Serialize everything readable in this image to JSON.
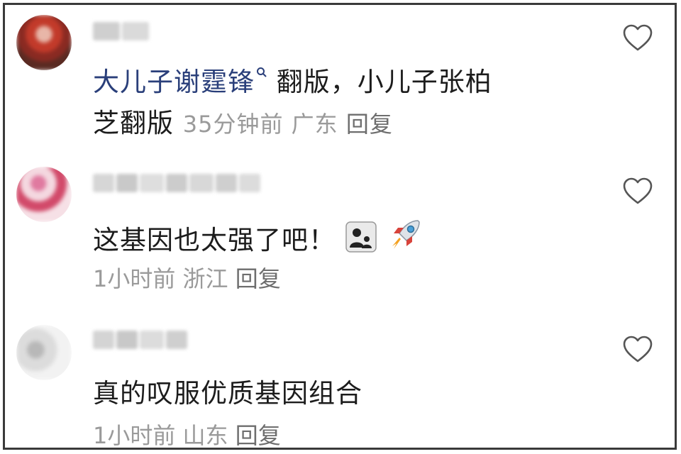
{
  "comments": [
    {
      "mention": "大儿子谢霆锋",
      "text_after_mention": " 翻版，小儿子张柏",
      "text_line2": "芝翻版",
      "time": "35分钟前",
      "location": "广东",
      "reply_label": "回复",
      "avatar_icon": "avatar-photo-blurred",
      "like_icon": "heart-outline-icon"
    },
    {
      "text": "这基因也太强了吧！",
      "emojis": [
        "busts-in-silhouette-emoji",
        "rocket-emoji"
      ],
      "time": "1小时前",
      "location": "浙江",
      "reply_label": "回复",
      "avatar_icon": "avatar-photo-blurred",
      "like_icon": "heart-outline-icon"
    },
    {
      "text": "真的叹服优质基因组合",
      "time": "1小时前",
      "location": "山东",
      "reply_label": "回复",
      "avatar_icon": "avatar-photo-blurred",
      "like_icon": "heart-outline-icon"
    }
  ],
  "colors": {
    "mention": "#2a3f7a",
    "meta": "#9a9a9a",
    "text": "#1c1c1c",
    "border": "#3a3a3a"
  }
}
